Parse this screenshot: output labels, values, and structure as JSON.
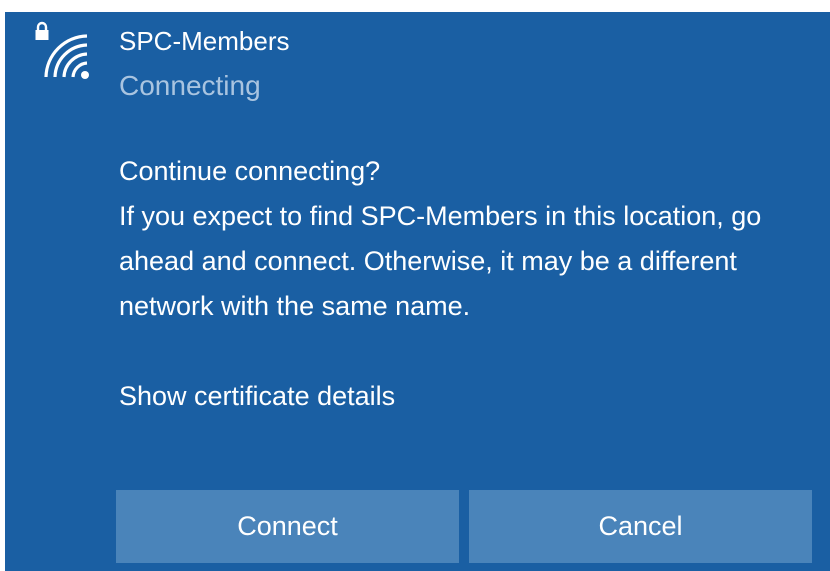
{
  "network": {
    "icon": "wifi-secured-icon",
    "ssid": "SPC-Members",
    "status": "Connecting"
  },
  "prompt": {
    "question": "Continue connecting?",
    "message": "If you expect to find SPC-Members in this location, go ahead and connect. Otherwise, it may be a different network with the same name.",
    "cert_link": "Show certificate details"
  },
  "buttons": {
    "connect": "Connect",
    "cancel": "Cancel"
  },
  "colors": {
    "background": "#1a5fa3",
    "button": "#4a84ba",
    "status_text": "#a9c4e0"
  }
}
